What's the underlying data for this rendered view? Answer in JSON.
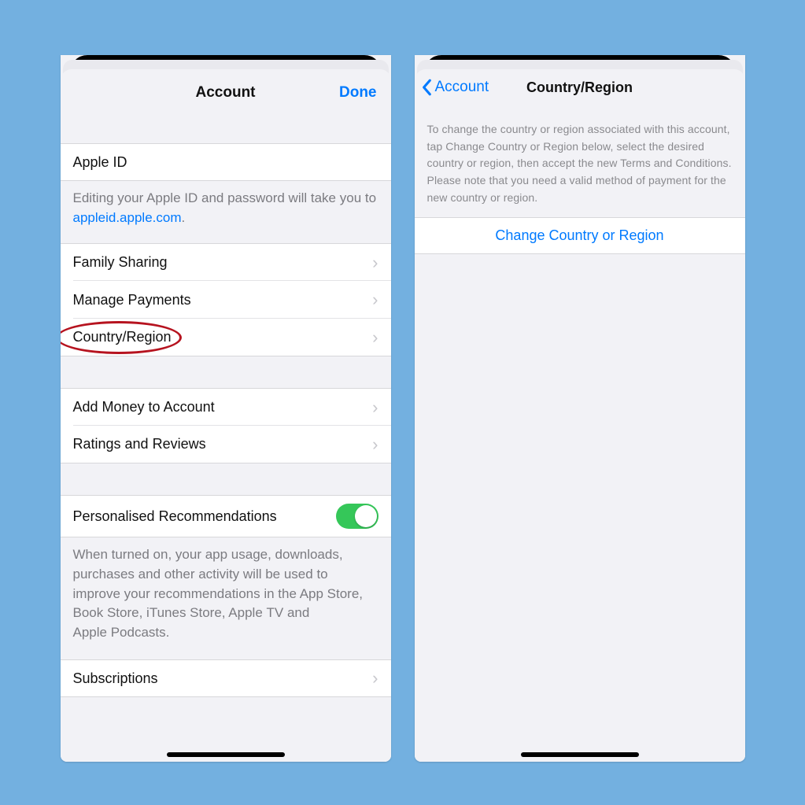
{
  "left": {
    "title": "Account",
    "done": "Done",
    "apple_id_label": "Apple ID",
    "apple_id_desc_prefix": "Editing your Apple ID and password will take you to ",
    "apple_id_link": "appleid.apple.com",
    "apple_id_desc_suffix": ".",
    "items_group1": {
      "family_sharing": "Family Sharing",
      "manage_payments": "Manage Payments",
      "country_region": "Country/Region"
    },
    "items_group2": {
      "add_money": "Add Money to Account",
      "ratings": "Ratings and Reviews"
    },
    "personalised": "Personalised Recommendations",
    "personalised_desc": "When turned on, your app usage, downloads, purchases and other activity will be used to improve your recommendations in the App Store, Book Store, iTunes Store, Apple TV and Apple Podcasts.",
    "subscriptions": "Subscriptions"
  },
  "right": {
    "back_label": "Account",
    "title": "Country/Region",
    "instructions": "To change the country or region associated with this account, tap Change Country or Region below, select the desired country or region, then accept the new Terms and Conditions. Please note that you need a valid method of payment for the new country or region.",
    "action": "Change Country or Region"
  }
}
